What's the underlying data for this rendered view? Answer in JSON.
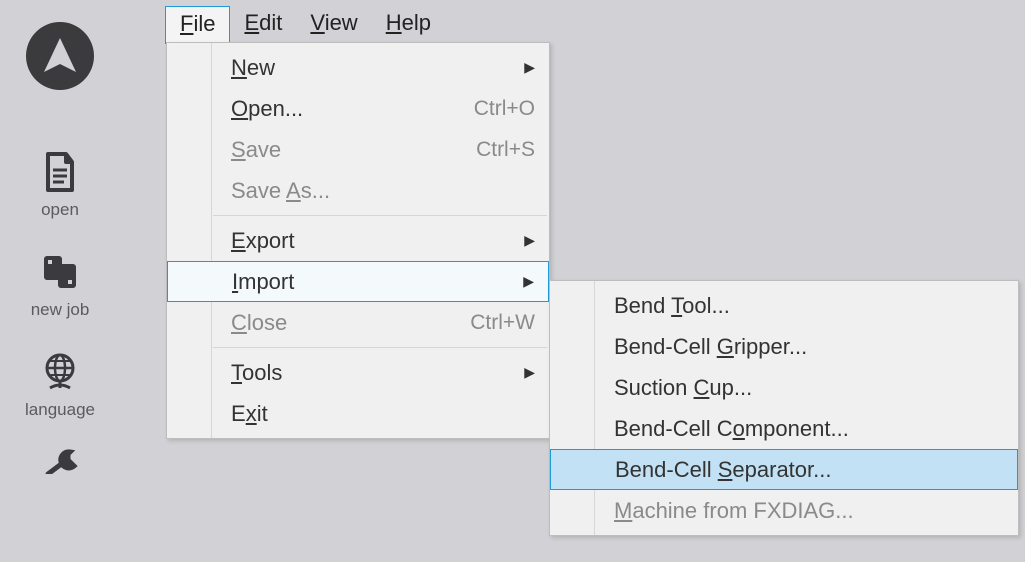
{
  "menubar": {
    "file": "File",
    "edit": "Edit",
    "view": "View",
    "help": "Help"
  },
  "file_menu": {
    "new": "New",
    "open": "Open...",
    "open_shortcut": "Ctrl+O",
    "save": "Save",
    "save_shortcut": "Ctrl+S",
    "save_as": "Save As...",
    "export": "Export",
    "import": "Import",
    "close": "Close",
    "close_shortcut": "Ctrl+W",
    "tools": "Tools",
    "exit": "Exit"
  },
  "import_submenu": {
    "bend_tool": "Bend Tool...",
    "bend_cell_gripper": "Bend-Cell Gripper...",
    "suction_cup": "Suction Cup...",
    "bend_cell_component": "Bend-Cell Component...",
    "bend_cell_separator": "Bend-Cell Separator...",
    "machine_from_fxdiag": "Machine from FXDIAG..."
  },
  "sidebar": {
    "open": "open",
    "new_job": "new job",
    "language": "language"
  }
}
